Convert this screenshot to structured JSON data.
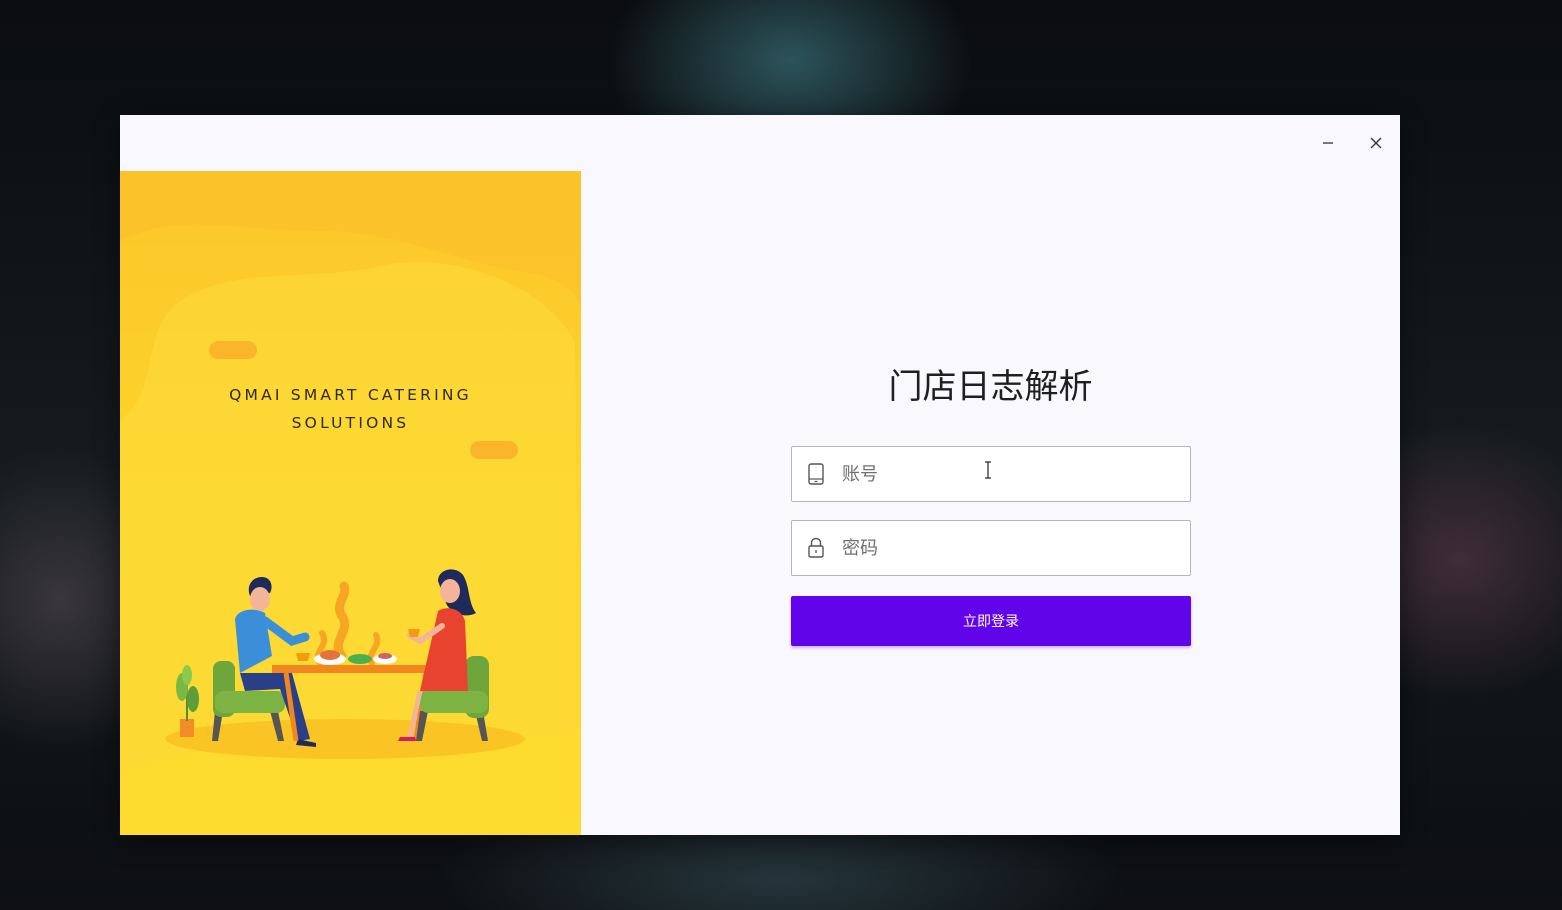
{
  "window": {
    "minimize_icon": "minimize-icon",
    "close_icon": "close-icon"
  },
  "left_panel": {
    "slogan_line1": "QMAI SMART CATERING",
    "slogan_line2": "SOLUTIONS"
  },
  "login": {
    "title": "门店日志解析",
    "account": {
      "placeholder": "账号",
      "value": "",
      "icon": "phone-icon"
    },
    "password": {
      "placeholder": "密码",
      "value": "",
      "icon": "lock-icon"
    },
    "submit_label": "立即登录"
  },
  "colors": {
    "accent": "#6204ea",
    "panel_yellow": "#fdd52a",
    "window_bg": "#f9f9fd"
  }
}
